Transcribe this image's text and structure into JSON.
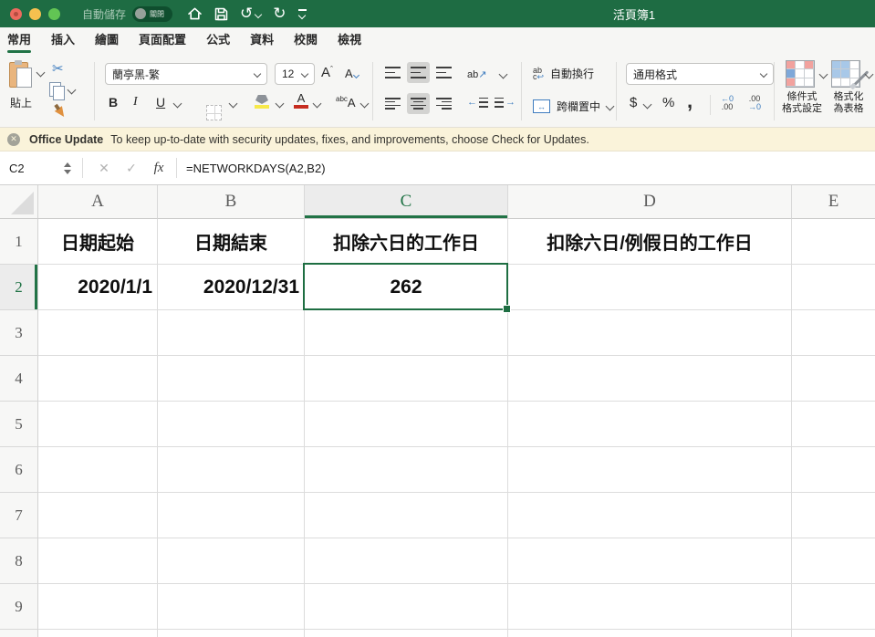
{
  "titlebar": {
    "title": "活頁簿1",
    "autosave_label": "自動儲存",
    "autosave_state": "關閉"
  },
  "tabs": {
    "items": [
      {
        "label": "常用",
        "active": true
      },
      {
        "label": "插入",
        "active": false
      },
      {
        "label": "繪圖",
        "active": false
      },
      {
        "label": "頁面配置",
        "active": false
      },
      {
        "label": "公式",
        "active": false
      },
      {
        "label": "資料",
        "active": false
      },
      {
        "label": "校閱",
        "active": false
      },
      {
        "label": "檢視",
        "active": false
      }
    ]
  },
  "ribbon": {
    "paste_label": "貼上",
    "font": {
      "name": "蘭亭黑-繁",
      "size": "12",
      "bold": "B",
      "italic": "I",
      "underline": "U",
      "effects_small": "abc",
      "effects_big": "A",
      "grow": "A",
      "shrink": "A"
    },
    "alignment": {
      "orientation_text": "ab",
      "orientation_arrow": "↗",
      "wrap_label": "自動換行",
      "wrap_t1": "ab",
      "wrap_t2": "c",
      "wrap_arrow": "↩",
      "merge_label": "跨欄置中",
      "merge_glyph": "↔"
    },
    "number": {
      "format": "通用格式",
      "currency": "$",
      "percent": "%",
      "comma": ",",
      "inc_line1": "←0",
      "inc_line2": ".00",
      "dec_line1": ".00",
      "dec_line2": "→0"
    },
    "styles": {
      "conditional_line1": "條件式",
      "conditional_line2": "格式設定",
      "table_line1": "格式化",
      "table_line2": "為表格"
    }
  },
  "update_bar": {
    "close_glyph": "✕",
    "title": "Office Update",
    "message": "To keep up-to-date with security updates, fixes, and improvements, choose Check for Updates."
  },
  "formula_bar": {
    "cell_ref": "C2",
    "cancel_glyph": "✕",
    "enter_glyph": "✓",
    "fx_glyph": "fx",
    "formula": "=NETWORKDAYS(A2,B2)"
  },
  "icons": {
    "cut": "✂",
    "undo": "↺",
    "redo": "↻"
  },
  "sheet": {
    "column_headers": [
      "A",
      "B",
      "C",
      "D",
      "E"
    ],
    "row_headers": [
      "1",
      "2",
      "3",
      "4",
      "5",
      "6",
      "7",
      "8",
      "9"
    ],
    "selected_column": "C",
    "selected_row": "2",
    "selected_cell": "C2",
    "cells": {
      "A1": "日期起始",
      "B1": "日期結束",
      "C1": "扣除六日的工作日",
      "D1": "扣除六日/例假日的工作日",
      "A2": "2020/1/1",
      "B2": "2020/12/31",
      "C2": "262"
    }
  },
  "colors": {
    "titlebar_green": "#1e6c43",
    "accent_green": "#217346",
    "selection_green": "#1e6e42",
    "update_bar_bg": "#faf3da"
  }
}
